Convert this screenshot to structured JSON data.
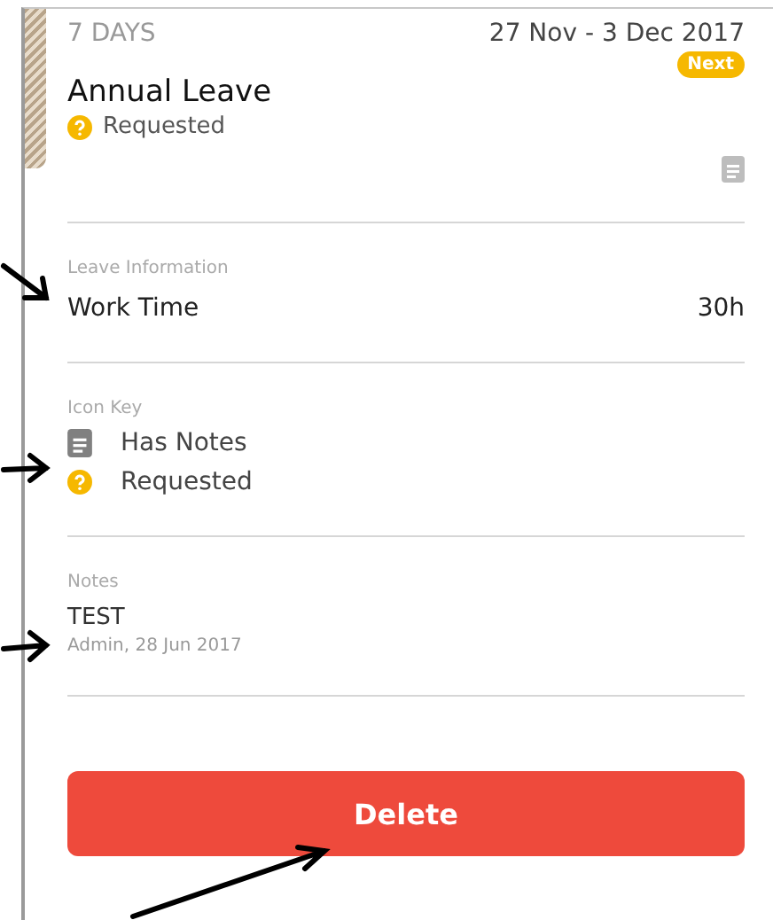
{
  "header": {
    "duration": "7 DAYS",
    "date_range": "27 Nov - 3 Dec 2017",
    "badge": "Next",
    "title": "Annual Leave",
    "status": "Requested",
    "has_notes": true
  },
  "leave_information": {
    "heading": "Leave Information",
    "rows": [
      {
        "label": "Work Time",
        "value": "30h"
      }
    ]
  },
  "icon_key": {
    "heading": "Icon Key",
    "items": [
      {
        "kind": "notes",
        "label": "Has Notes"
      },
      {
        "kind": "requested",
        "label": "Requested"
      }
    ]
  },
  "notes": {
    "heading": "Notes",
    "text": "TEST",
    "meta": "Admin, 28 Jun 2017"
  },
  "delete_button": "Delete"
}
